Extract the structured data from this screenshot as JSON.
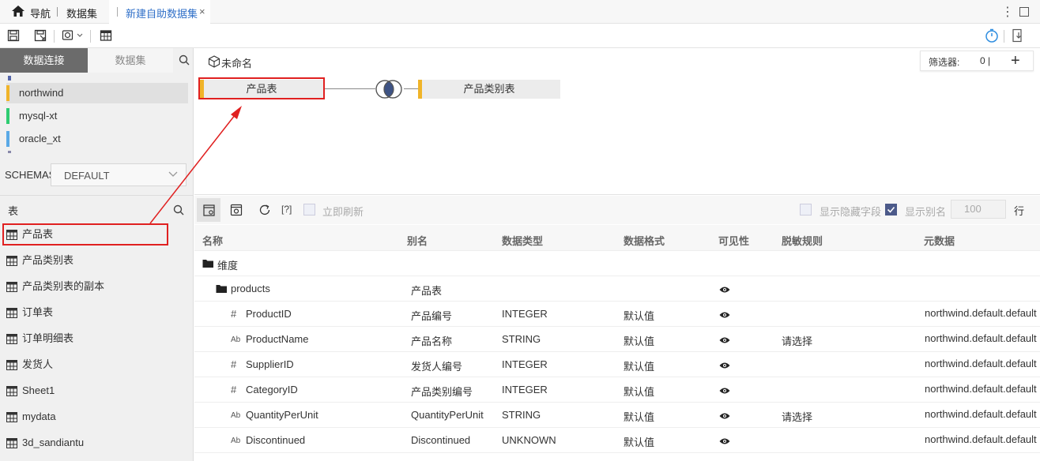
{
  "topbar": {
    "nav_label": "导航",
    "datasets_label": "数据集",
    "tab_label": "新建自助数据集",
    "close_glyph": "×",
    "more_glyph": "⋮"
  },
  "left": {
    "tab_connections": "数据连接",
    "tab_datasets": "数据集",
    "connections": [
      {
        "label": "northwind",
        "color": "#f0b429",
        "selected": true
      },
      {
        "label": "mysql-xt",
        "color": "#2ecc71"
      },
      {
        "label": "oracle_xt",
        "color": "#5aa9e6"
      }
    ],
    "schemas_label": "SCHEMAS",
    "schema_value": "DEFAULT",
    "tables_label": "表",
    "tables": [
      "产品表",
      "产品类别表",
      "产品类别表的副本",
      "订单表",
      "订单明细表",
      "发货人",
      "Sheet1",
      "mydata",
      "3d_sandiantu"
    ]
  },
  "canvas": {
    "dataset_name": "未命名",
    "filter_label": "筛选器:",
    "filter_count": "0 |",
    "filter_add": "+",
    "node_left": "产品表",
    "node_right": "产品类别表"
  },
  "gridbar": {
    "qmark": "[?]",
    "refresh_label": "立即刷新",
    "show_hidden_label": "显示隐藏字段",
    "show_alias_label": "显示别名",
    "rows_value": "100",
    "rows_unit": "行"
  },
  "grid": {
    "headers": {
      "name": "名称",
      "alias": "别名",
      "data_type": "数据类型",
      "data_format": "数据格式",
      "visible": "可见性",
      "mask_rule": "脱敏规则",
      "metadata": "元数据"
    },
    "dimension_folder": "维度",
    "table_folder": {
      "name": "products",
      "alias": "产品表"
    },
    "rows": [
      {
        "type_icon": "#",
        "name": "ProductID",
        "alias": "产品编号",
        "data_type": "INTEGER",
        "format": "默认值",
        "mask": "",
        "meta": "northwind.default.default"
      },
      {
        "type_icon": "Ab",
        "name": "ProductName",
        "alias": "产品名称",
        "data_type": "STRING",
        "format": "默认值",
        "mask": "请选择",
        "meta": "northwind.default.default"
      },
      {
        "type_icon": "#",
        "name": "SupplierID",
        "alias": "发货人编号",
        "data_type": "INTEGER",
        "format": "默认值",
        "mask": "",
        "meta": "northwind.default.default"
      },
      {
        "type_icon": "#",
        "name": "CategoryID",
        "alias": "产品类别编号",
        "data_type": "INTEGER",
        "format": "默认值",
        "mask": "",
        "meta": "northwind.default.default"
      },
      {
        "type_icon": "Ab",
        "name": "QuantityPerUnit",
        "alias": "QuantityPerUnit",
        "data_type": "STRING",
        "format": "默认值",
        "mask": "请选择",
        "meta": "northwind.default.default"
      },
      {
        "type_icon": "Ab",
        "name": "Discontinued",
        "alias": "Discontinued",
        "data_type": "UNKNOWN",
        "format": "默认值",
        "mask": "",
        "meta": "northwind.default.default"
      }
    ]
  },
  "colors": {
    "accent_blue": "#2f6fc8",
    "highlight_red": "#e02020",
    "node_bar": "#f0b429"
  }
}
